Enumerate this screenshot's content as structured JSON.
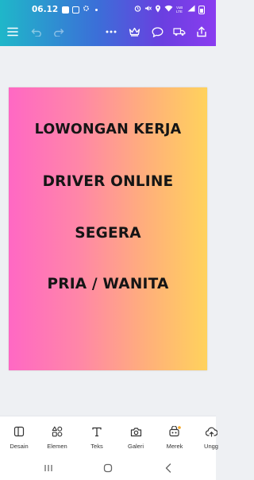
{
  "status_bar": {
    "time": "06.12",
    "network_label": "VoB LTE",
    "icons": [
      "message-icon",
      "gallery-icon",
      "settings-notification-icon",
      "dot-icon",
      "alarm-icon",
      "mute-icon",
      "location-icon",
      "wifi-icon",
      "signal-icon",
      "battery-icon"
    ]
  },
  "toolbar": {
    "icons": [
      "menu-icon",
      "undo-icon",
      "redo-icon",
      "more-icon",
      "crown-icon",
      "comment-icon",
      "truck-icon",
      "share-icon"
    ]
  },
  "design": {
    "lines": [
      "LOWONGAN KERJA",
      "DRIVER ONLINE",
      "SEGERA",
      "PRIA / WANITA"
    ],
    "gradient": [
      "#ff68c4",
      "#ffd25c"
    ]
  },
  "bottom_tabs": [
    {
      "label": "Desain",
      "icon": "design-icon"
    },
    {
      "label": "Elemen",
      "icon": "elements-icon"
    },
    {
      "label": "Teks",
      "icon": "text-icon"
    },
    {
      "label": "Galeri",
      "icon": "camera-icon"
    },
    {
      "label": "Merek",
      "icon": "brand-icon"
    },
    {
      "label": "Ungg",
      "icon": "upload-icon"
    }
  ],
  "nav_bar": {
    "icons": [
      "recent-apps-icon",
      "home-icon",
      "back-icon"
    ]
  },
  "colors": {
    "top_gradient_start": "#1fb7c9",
    "top_gradient_end": "#8a3cf0",
    "canvas_bg": "#eef0f3"
  }
}
